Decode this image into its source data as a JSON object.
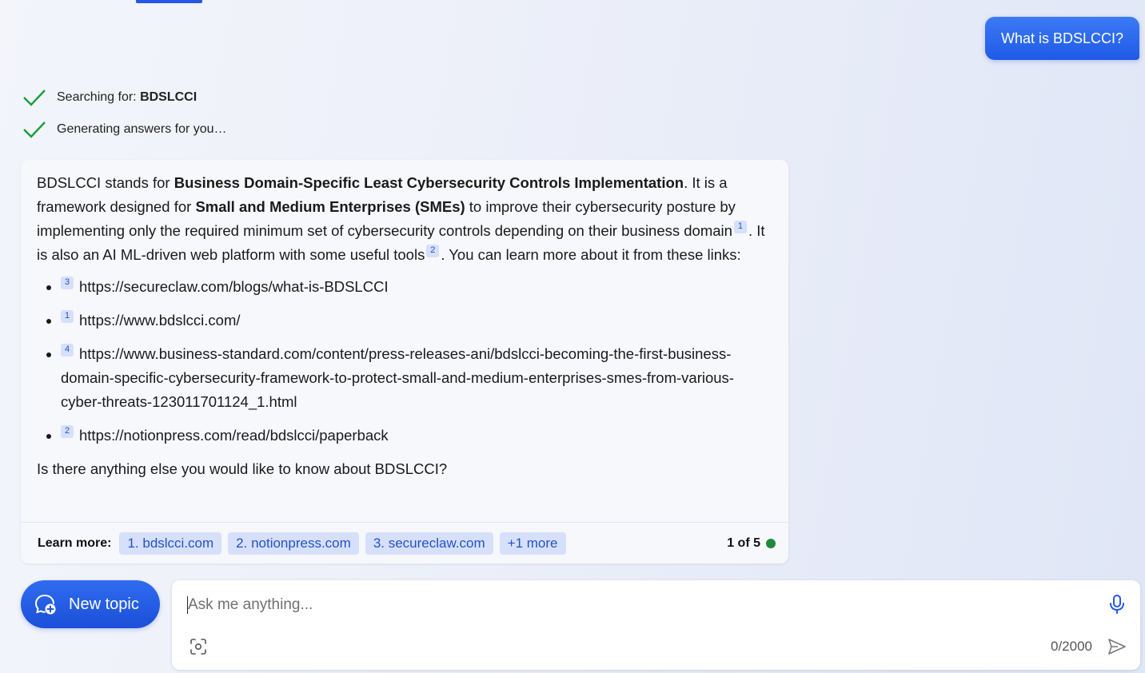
{
  "user_message": "What is BDSLCCI?",
  "status": {
    "searching_prefix": "Searching for: ",
    "searching_term": "BDSLCCI",
    "generating": "Generating answers for you…"
  },
  "answer": {
    "p1_a": "BDSLCCI stands for ",
    "p1_b": "Business Domain-Specific Least Cybersecurity Controls Implementation",
    "p1_c": ". It is a framework designed for ",
    "p1_d": "Small and Medium Enterprises (SMEs)",
    "p1_e": " to improve their cybersecurity posture by implementing only the required minimum set of cybersecurity controls depending on their business domain",
    "p1_cite1": "1",
    "p1_f": ". It is also an AI ML-driven web platform with some useful tools",
    "p1_cite2": "2",
    "p1_g": ". You can learn more about it from these links:",
    "links": [
      {
        "cite": "3",
        "url": "https://secureclaw.com/blogs/what-is-BDSLCCI"
      },
      {
        "cite": "1",
        "url": "https://www.bdslcci.com/"
      },
      {
        "cite": "4",
        "url": "https://www.business-standard.com/content/press-releases-ani/bdslcci-becoming-the-first-business-domain-specific-cybersecurity-framework-to-protect-small-and-medium-enterprises-smes-from-various-cyber-threats-123011701124_1.html"
      },
      {
        "cite": "2",
        "url": "https://notionpress.com/read/bdslcci/paperback"
      }
    ],
    "closing": "Is there anything else you would like to know about BDSLCCI?"
  },
  "learn_more": {
    "label": "Learn more:",
    "chips": [
      "1. bdslcci.com",
      "2. notionpress.com",
      "3. secureclaw.com",
      "+1 more"
    ],
    "page_counter": "1 of 5",
    "status_color": "#1e8a3c"
  },
  "new_topic_label": "New topic",
  "input": {
    "placeholder": "Ask me anything...",
    "char_counter": "0/2000"
  },
  "colors": {
    "accent": "#2457e6",
    "chip_bg": "#d6e0fb",
    "check": "#1a9e3a"
  }
}
